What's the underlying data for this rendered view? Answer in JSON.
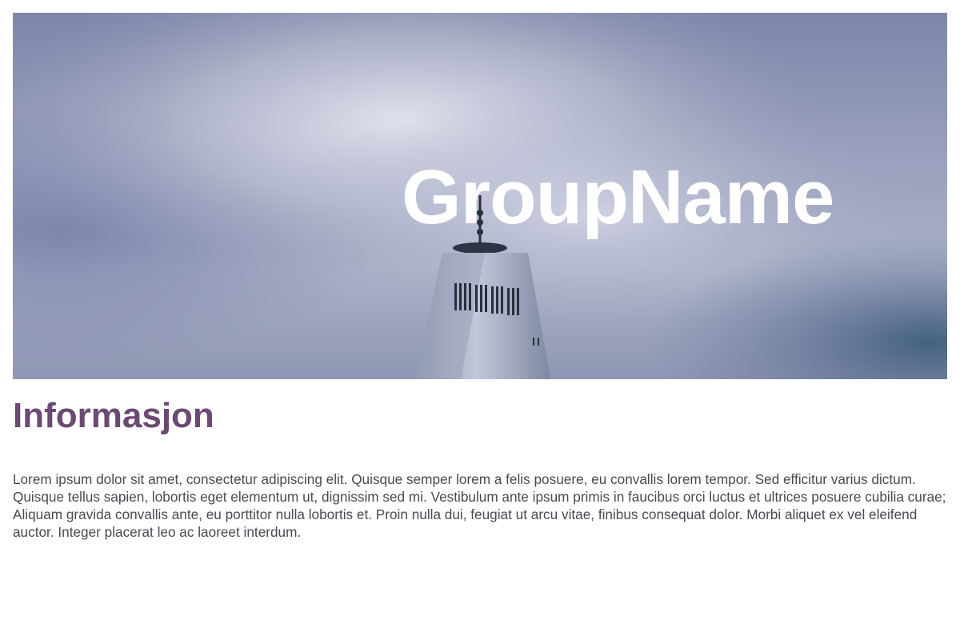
{
  "hero": {
    "title": "GroupName",
    "image": "skyscraper-sky-photo"
  },
  "info": {
    "heading": "Informasjon",
    "text": "Lorem ipsum dolor sit amet, consectetur adipiscing elit. Quisque semper lorem a felis posuere, eu convallis lorem tempor. Sed efficitur varius dictum. Quisque tellus sapien, lobortis eget elementum ut, dignissim sed mi. Vestibulum ante ipsum primis in faucibus orci luctus et ultrices posuere cubilia curae; Aliquam gravida convallis ante, eu porttitor nulla lobortis et. Proin nulla dui, feugiat ut arcu vitae, finibus consequat dolor. Morbi aliquet ex vel eleifend auctor. Integer placerat leo ac laoreet interdum."
  },
  "colors": {
    "heading": "#6b4a72",
    "body_text": "#4a4a52",
    "hero_text": "#ffffff"
  }
}
